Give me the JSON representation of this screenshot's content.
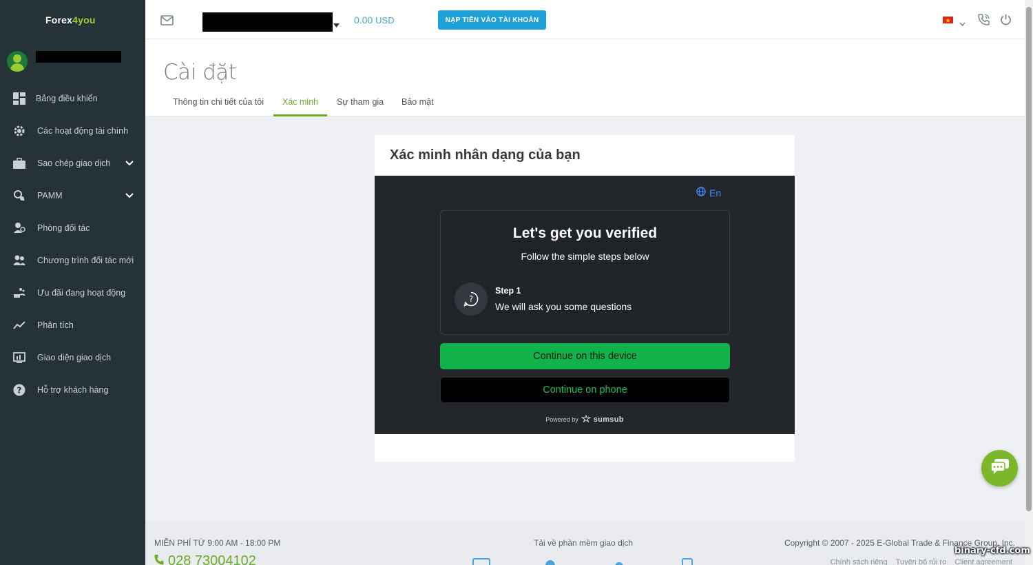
{
  "brand": {
    "logo_part1": "Forex",
    "logo_part2": "4you"
  },
  "sidebar": {
    "items": [
      {
        "label": "Bảng điều khiển",
        "icon": "dashboard-icon"
      },
      {
        "label": "Các hoạt động tài chính",
        "icon": "gear-icon"
      },
      {
        "label": "Sao chép giao dịch",
        "icon": "briefcase-icon",
        "expandable": true
      },
      {
        "label": "PAMM",
        "icon": "pamm-icon",
        "expandable": true
      },
      {
        "label": "Phòng đối tác",
        "icon": "partner-icon"
      },
      {
        "label": "Chương trình đối tác mới",
        "icon": "users-icon"
      },
      {
        "label": "Ưu đãi đang hoạt động",
        "icon": "gift-icon"
      },
      {
        "label": "Phân tích",
        "icon": "chart-line-icon"
      },
      {
        "label": "Giao diện giao dịch",
        "icon": "terminal-icon"
      },
      {
        "label": "Hỗ trợ khách hàng",
        "icon": "help-icon"
      }
    ]
  },
  "topbar": {
    "balance": "0.00",
    "currency": "USD",
    "deposit_label": "NẠP TIỀN VÀO TÀI KHOẢN"
  },
  "header": {
    "title": "Cài đặt",
    "tabs": [
      {
        "label": "Thông tin chi tiết của tôi",
        "active": false
      },
      {
        "label": "Xác minh",
        "active": true
      },
      {
        "label": "Sự tham gia",
        "active": false
      },
      {
        "label": "Bảo mật",
        "active": false
      }
    ]
  },
  "card": {
    "title": "Xác minh nhân dạng của bạn",
    "widget": {
      "language": "En",
      "heading": "Let's get you verified",
      "subheading": "Follow the simple steps below",
      "step_label": "Step 1",
      "step_text": "We will ask you some questions",
      "continue_device": "Continue on this device",
      "continue_phone": "Continue on phone",
      "powered_by": "Powered by",
      "powered_brand": "sumsub"
    }
  },
  "footer": {
    "hours": "MIỄN PHÍ TỪ 9:00 AM - 18:00 PM",
    "phone": "028 73004102",
    "download": "Tải về phần mềm giao dịch",
    "copyright": "Copyright © 2007 - 2025 E-Global Trade & Finance Group, Inc.",
    "links": [
      "Chính sách riêng",
      "Tuyên bố rủi ro",
      "Client agreement"
    ]
  },
  "watermark": "binary-cfd.com",
  "colors": {
    "accent_green": "#6dab2b",
    "deposit_blue": "#1ea1d8",
    "sidebar_bg": "#253238",
    "widget_bg": "#23262b",
    "cta_green": "#12b24b"
  }
}
